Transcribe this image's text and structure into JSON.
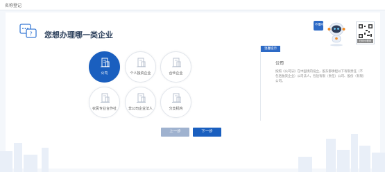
{
  "window": {
    "title": "名称登记"
  },
  "page": {
    "title": "您想办理哪一类企业"
  },
  "robot": {
    "bubble_text": "不懂问我"
  },
  "qr": {
    "label": "扫码小程序"
  },
  "options": [
    {
      "label": "公司",
      "selected": true
    },
    {
      "label": "个人独资企业",
      "selected": false
    },
    {
      "label": "合伙企业",
      "selected": false
    },
    {
      "label": "农民专业合作社",
      "selected": false
    },
    {
      "label": "非公司企业法人",
      "selected": false
    },
    {
      "label": "分支机构",
      "selected": false
    }
  ],
  "tip": {
    "tag": "温馨提示",
    "title": "公司",
    "text": "按照《公司法》在中国境内设立，股东都承担以下有限责任（不包括独资企业）公司法人，包括有限（责任）公司、股份（有限）公司。"
  },
  "buttons": {
    "prev": "上一步",
    "next": "下一步"
  },
  "colors": {
    "accent": "#1a5fbf",
    "disabled": "#9fb2cf",
    "tag": "#2d6ac6"
  }
}
